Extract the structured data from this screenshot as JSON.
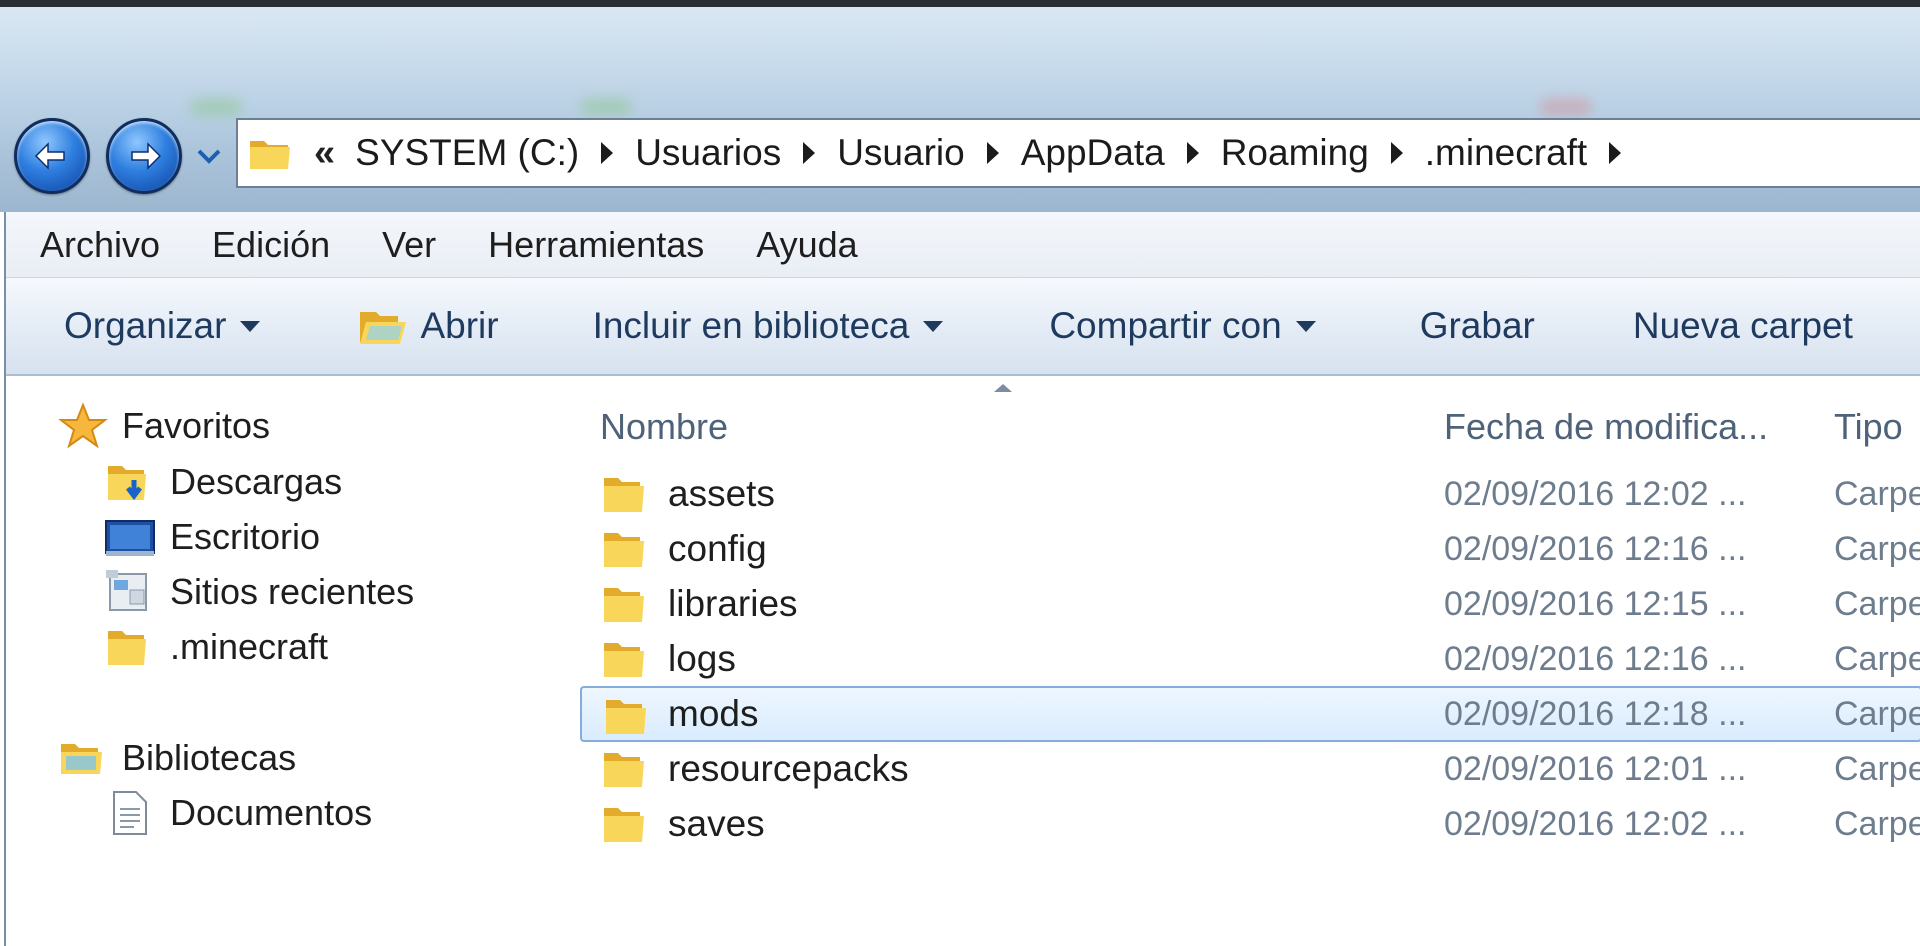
{
  "address": {
    "overflow_chevron": "«",
    "crumbs": [
      "SYSTEM (C:)",
      "Usuarios",
      "Usuario",
      "AppData",
      "Roaming",
      ".minecraft"
    ]
  },
  "menu": [
    "Archivo",
    "Edición",
    "Ver",
    "Herramientas",
    "Ayuda"
  ],
  "toolbar": {
    "organize": "Organizar",
    "open": "Abrir",
    "include_library": "Incluir en biblioteca",
    "share_with": "Compartir con",
    "burn": "Grabar",
    "new_folder": "Nueva carpet"
  },
  "nav": {
    "favorites": {
      "label": "Favoritos",
      "items": [
        {
          "label": "Descargas",
          "icon": "downloads-folder-icon"
        },
        {
          "label": "Escritorio",
          "icon": "desktop-icon"
        },
        {
          "label": "Sitios recientes",
          "icon": "recent-places-icon"
        },
        {
          "label": ".minecraft",
          "icon": "folder-icon"
        }
      ]
    },
    "libraries": {
      "label": "Bibliotecas",
      "items": [
        {
          "label": "Documentos",
          "icon": "document-icon"
        }
      ]
    }
  },
  "columns": {
    "name": "Nombre",
    "date": "Fecha de modifica...",
    "type": "Tipo"
  },
  "files": [
    {
      "name": "assets",
      "date": "02/09/2016 12:02 ...",
      "type": "Carpe"
    },
    {
      "name": "config",
      "date": "02/09/2016 12:16 ...",
      "type": "Carpe"
    },
    {
      "name": "libraries",
      "date": "02/09/2016 12:15 ...",
      "type": "Carpe"
    },
    {
      "name": "logs",
      "date": "02/09/2016 12:16 ...",
      "type": "Carpe"
    },
    {
      "name": "mods",
      "date": "02/09/2016 12:18 ...",
      "type": "Carpe",
      "selected": true
    },
    {
      "name": "resourcepacks",
      "date": "02/09/2016 12:01 ...",
      "type": "Carpe"
    },
    {
      "name": "saves",
      "date": "02/09/2016 12:02 ...",
      "type": "Carpe"
    }
  ],
  "colors": {
    "accent": "#2f7fe0",
    "selection_border": "#84acdd",
    "folder_yellow": "#f3c94a"
  }
}
